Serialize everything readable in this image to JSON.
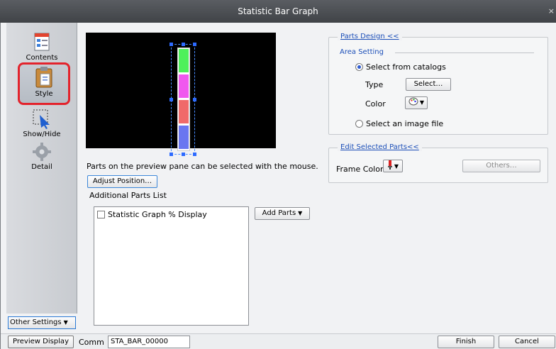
{
  "window": {
    "title": "Statistic Bar Graph",
    "close_glyph": "×"
  },
  "sidebar": {
    "items": [
      {
        "label": "Contents",
        "icon": "contents-icon",
        "selected": false
      },
      {
        "label": "Style",
        "icon": "style-clipboard-icon",
        "selected": true
      },
      {
        "label": "Show/Hide",
        "icon": "show-hide-cursor-icon",
        "selected": false
      },
      {
        "label": "Detail",
        "icon": "gear-icon",
        "selected": false
      }
    ],
    "other_settings_label": "Other Settings",
    "highlight_color": "#e3232c"
  },
  "preview": {
    "background": "#000000",
    "segments": [
      {
        "color": "#4ef05a"
      },
      {
        "color": "#f058ee"
      },
      {
        "color": "#f06a6a"
      },
      {
        "color": "#6a76f0"
      }
    ],
    "hint": "Parts on the preview pane can be selected with the mouse.",
    "adjust_button": "Adjust Position…"
  },
  "additional_parts": {
    "label": "Additional Parts List",
    "items": [
      {
        "label": "Statistic Graph % Display",
        "checked": false
      }
    ],
    "add_button": "Add Parts"
  },
  "parts_design": {
    "title": "Parts Design <<",
    "area_setting": "Area Setting",
    "option_catalog": "Select from catalogs",
    "option_catalog_selected": true,
    "type_label": "Type",
    "select_button": "Select…",
    "color_label": "Color",
    "option_image": "Select an image file"
  },
  "edit_selected": {
    "title": "Edit Selected Parts<<",
    "frame_color_label": "Frame Color",
    "others_button": "Others…"
  },
  "footer": {
    "preview_display": "Preview Display",
    "comm_label": "Comm",
    "comm_value": "STA_BAR_00000",
    "finish": "Finish",
    "cancel": "Cancel"
  }
}
